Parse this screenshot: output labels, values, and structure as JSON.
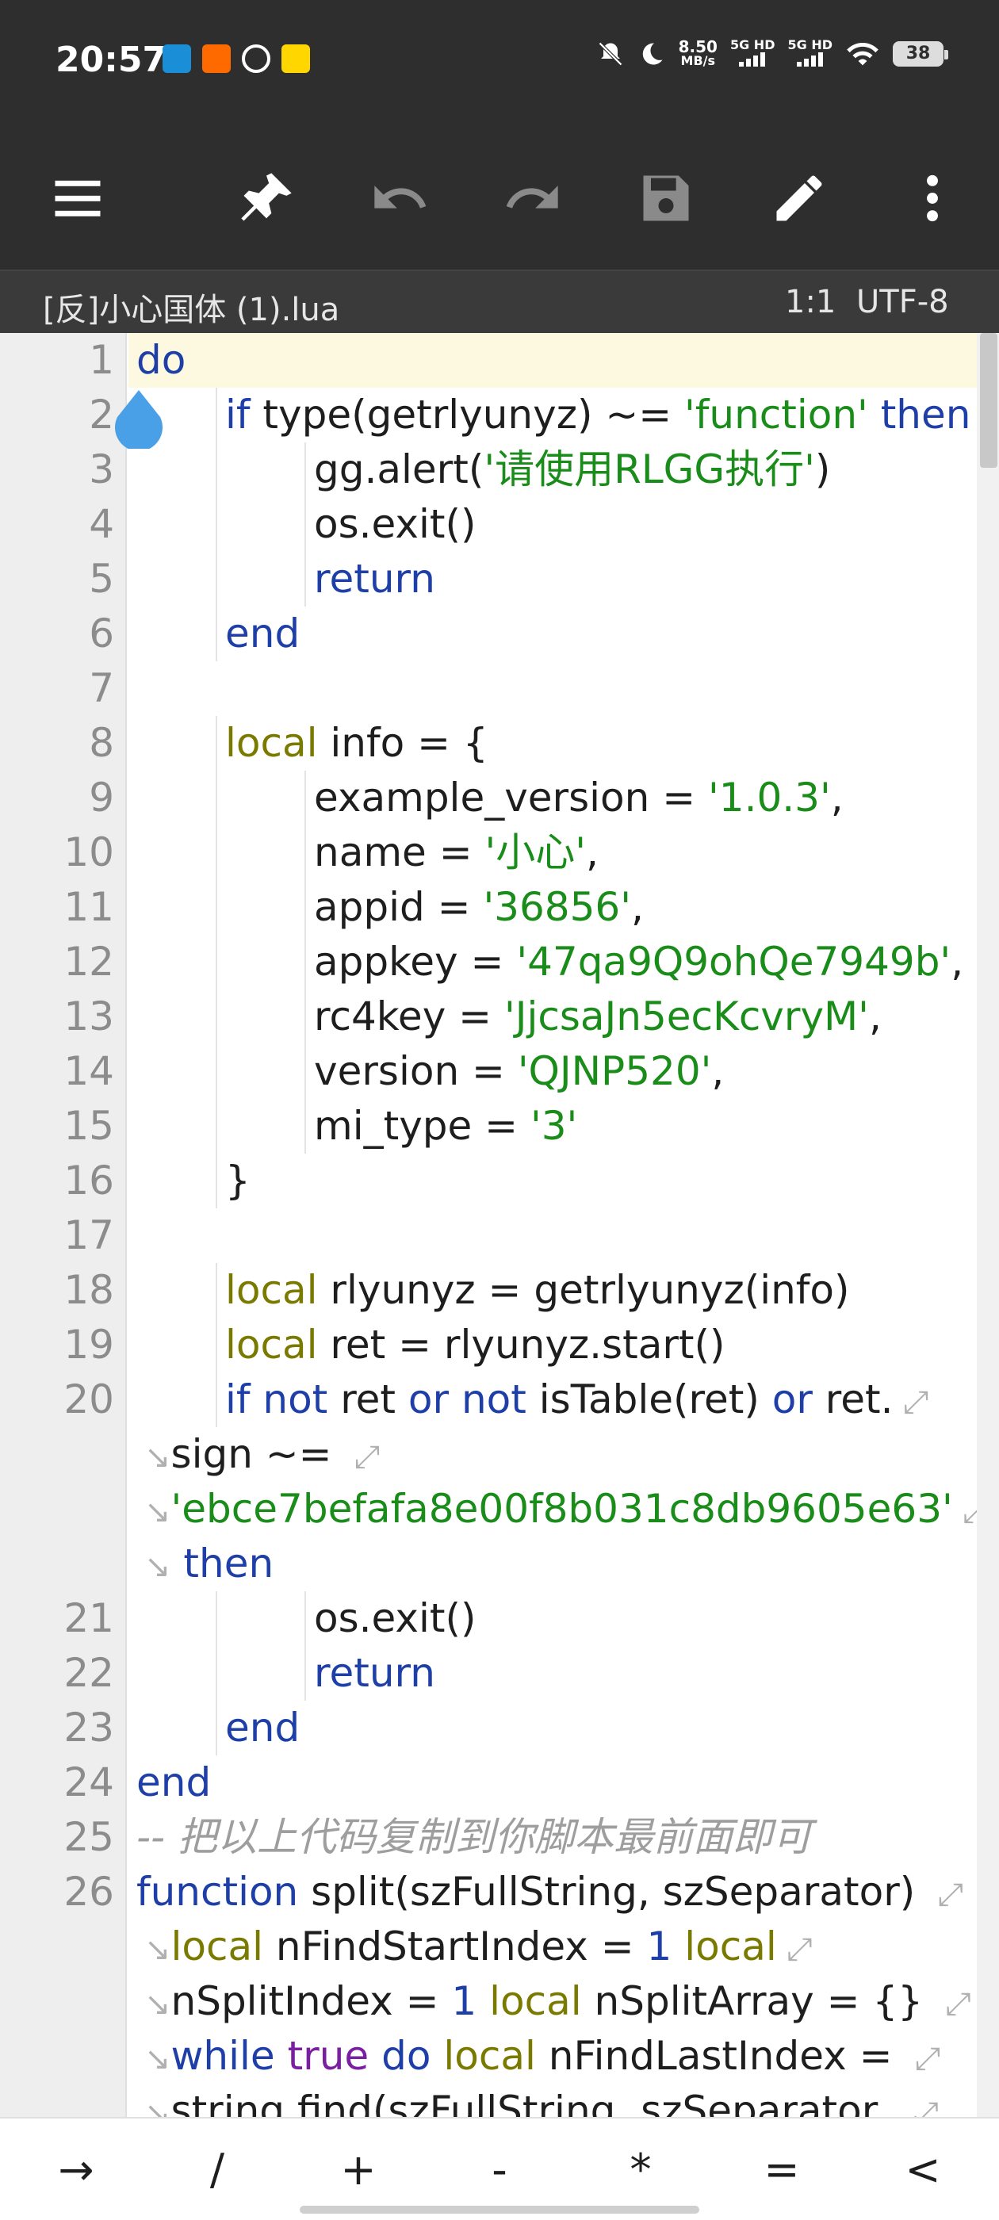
{
  "statusbar": {
    "time": "20:57",
    "speed_top": "8.50",
    "speed_bottom": "MB/s",
    "net1": "5G HD",
    "net2": "5G HD",
    "battery": "38",
    "notif_colors": [
      "#1a8fd8",
      "#ff6a00",
      "#2e2e2e",
      "#ffd600"
    ]
  },
  "toolbar": {
    "icons": [
      "menu-icon",
      "pin-icon",
      "undo-icon",
      "redo-icon",
      "save-icon",
      "edit-icon",
      "more-vert-icon"
    ]
  },
  "filebar": {
    "filename": "[反]小心国体 (1).lua",
    "cursor": "1:1",
    "encoding": "UTF-8"
  },
  "code_lines": [
    {
      "n": "1",
      "segs": [
        [
          "kw",
          "do"
        ]
      ],
      "indent": 0
    },
    {
      "n": "2",
      "segs": [
        [
          "kw",
          "if"
        ],
        [
          "",
          " type(getrlyunyz) ~= "
        ],
        [
          "str",
          "'function'"
        ],
        [
          "",
          " "
        ],
        [
          "kw",
          "then"
        ]
      ],
      "indent": 1
    },
    {
      "n": "3",
      "segs": [
        [
          "",
          "gg.alert("
        ],
        [
          "str",
          "'请使用RLGG执行'"
        ],
        [
          "",
          ")"
        ]
      ],
      "indent": 2
    },
    {
      "n": "4",
      "segs": [
        [
          "",
          "os.exit()"
        ]
      ],
      "indent": 2
    },
    {
      "n": "5",
      "segs": [
        [
          "kw",
          "return"
        ]
      ],
      "indent": 2
    },
    {
      "n": "6",
      "segs": [
        [
          "kw",
          "end"
        ]
      ],
      "indent": 1
    },
    {
      "n": "7",
      "segs": [],
      "indent": 0
    },
    {
      "n": "8",
      "segs": [
        [
          "lc",
          "local"
        ],
        [
          "",
          " info = {"
        ]
      ],
      "indent": 1
    },
    {
      "n": "9",
      "segs": [
        [
          "",
          "example_version = "
        ],
        [
          "str",
          "'1.0.3'"
        ],
        [
          "",
          ","
        ]
      ],
      "indent": 2
    },
    {
      "n": "10",
      "segs": [
        [
          "",
          "name = "
        ],
        [
          "str",
          "'小心'"
        ],
        [
          "",
          ","
        ]
      ],
      "indent": 2
    },
    {
      "n": "11",
      "segs": [
        [
          "",
          "appid = "
        ],
        [
          "str",
          "'36856'"
        ],
        [
          "",
          ","
        ]
      ],
      "indent": 2
    },
    {
      "n": "12",
      "segs": [
        [
          "",
          "appkey = "
        ],
        [
          "str",
          "'47qa9Q9ohQe7949b'"
        ],
        [
          "",
          ","
        ]
      ],
      "indent": 2
    },
    {
      "n": "13",
      "segs": [
        [
          "",
          "rc4key = "
        ],
        [
          "str",
          "'JjcsaJn5ecKcvryM'"
        ],
        [
          "",
          ","
        ]
      ],
      "indent": 2
    },
    {
      "n": "14",
      "segs": [
        [
          "",
          "version = "
        ],
        [
          "str",
          "'QJNP520'"
        ],
        [
          "",
          ","
        ]
      ],
      "indent": 2
    },
    {
      "n": "15",
      "segs": [
        [
          "",
          "mi_type = "
        ],
        [
          "str",
          "'3'"
        ]
      ],
      "indent": 2
    },
    {
      "n": "16",
      "segs": [
        [
          "",
          "}"
        ]
      ],
      "indent": 1
    },
    {
      "n": "17",
      "segs": [],
      "indent": 0
    },
    {
      "n": "18",
      "segs": [
        [
          "lc",
          "local"
        ],
        [
          "",
          " rlyunyz = getrlyunyz(info)"
        ]
      ],
      "indent": 1
    },
    {
      "n": "19",
      "segs": [
        [
          "lc",
          "local"
        ],
        [
          "",
          " ret = rlyunyz.start()"
        ]
      ],
      "indent": 1
    },
    {
      "n": "20",
      "segs": [
        [
          "kw",
          "if"
        ],
        [
          "",
          " "
        ],
        [
          "kw",
          "not"
        ],
        [
          "",
          " ret "
        ],
        [
          "kw",
          "or"
        ],
        [
          "",
          " "
        ],
        [
          "kw",
          "not"
        ],
        [
          "",
          " isTable(ret) "
        ],
        [
          "kw",
          "or"
        ],
        [
          "",
          " ret."
        ]
      ],
      "indent": 1,
      "wrap_end": true
    },
    {
      "n": "",
      "segs": [
        [
          "",
          "sign ~= "
        ]
      ],
      "indent": 0,
      "wrap_start": true,
      "wrap_end": true
    },
    {
      "n": "",
      "segs": [
        [
          "str",
          "'ebce7befafa8e00f8b031c8db9605e63'"
        ]
      ],
      "indent": 0,
      "wrap_start": true,
      "wrap_end": true
    },
    {
      "n": "",
      "segs": [
        [
          "",
          " "
        ],
        [
          "kw",
          "then"
        ]
      ],
      "indent": 0,
      "wrap_start": true
    },
    {
      "n": "21",
      "segs": [
        [
          "",
          "os.exit()"
        ]
      ],
      "indent": 2
    },
    {
      "n": "22",
      "segs": [
        [
          "kw",
          "return"
        ]
      ],
      "indent": 2
    },
    {
      "n": "23",
      "segs": [
        [
          "kw",
          "end"
        ]
      ],
      "indent": 1
    },
    {
      "n": "24",
      "segs": [
        [
          "kw",
          "end"
        ]
      ],
      "indent": 0
    },
    {
      "n": "25",
      "segs": [
        [
          "cm",
          "-- 把以上代码复制到你脚本最前面即可"
        ]
      ],
      "indent": 0
    },
    {
      "n": "26",
      "segs": [
        [
          "kw",
          "function"
        ],
        [
          "",
          " split(szFullString, szSeparator) "
        ]
      ],
      "indent": 0,
      "wrap_end": true
    },
    {
      "n": "",
      "segs": [
        [
          "lc",
          "local"
        ],
        [
          "",
          " nFindStartIndex = "
        ],
        [
          "num",
          "1"
        ],
        [
          "",
          " "
        ],
        [
          "lc",
          "local"
        ]
      ],
      "indent": 0,
      "wrap_start": true,
      "wrap_end": true
    },
    {
      "n": "",
      "segs": [
        [
          "",
          "nSplitIndex = "
        ],
        [
          "num",
          "1"
        ],
        [
          "",
          " "
        ],
        [
          "lc",
          "local"
        ],
        [
          "",
          " nSplitArray = {} "
        ]
      ],
      "indent": 0,
      "wrap_start": true,
      "wrap_end": true
    },
    {
      "n": "",
      "segs": [
        [
          "kw",
          "while"
        ],
        [
          "",
          " "
        ],
        [
          "pu",
          "true"
        ],
        [
          "",
          " "
        ],
        [
          "kw",
          "do"
        ],
        [
          "",
          " "
        ],
        [
          "lc",
          "local"
        ],
        [
          "",
          " nFindLastIndex = "
        ]
      ],
      "indent": 0,
      "wrap_start": true,
      "wrap_end": true
    },
    {
      "n": "",
      "segs": [
        [
          "",
          "string.find(szFullString, szSeparator, "
        ]
      ],
      "indent": 0,
      "wrap_start": true,
      "wrap_end": true
    }
  ],
  "symbols": [
    "→",
    "/",
    "+",
    "-",
    "*",
    "=",
    "<"
  ]
}
